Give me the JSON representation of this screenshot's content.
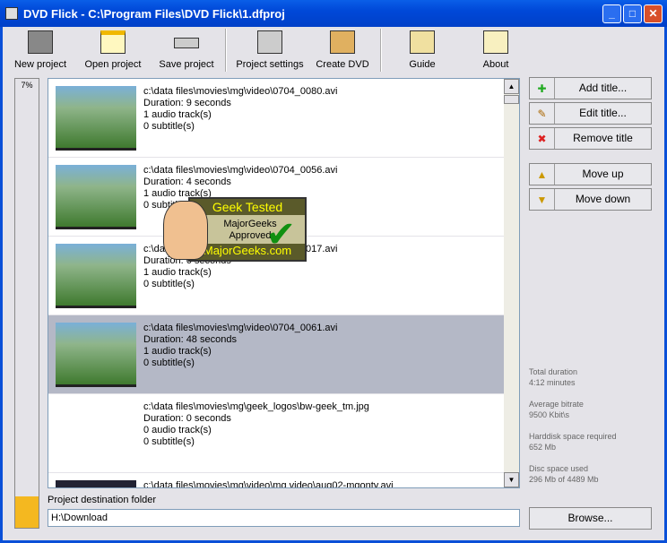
{
  "window": {
    "title": "DVD Flick - C:\\Program Files\\DVD Flick\\1.dfproj"
  },
  "toolbar": [
    {
      "label": "New project",
      "icon": "film-icon"
    },
    {
      "label": "Open project",
      "icon": "folder-icon"
    },
    {
      "label": "Save project",
      "icon": "drive-icon"
    },
    {
      "label": "Project settings",
      "icon": "settings-icon"
    },
    {
      "label": "Create DVD",
      "icon": "gears-icon"
    },
    {
      "label": "Guide",
      "icon": "guide-icon"
    },
    {
      "label": "About",
      "icon": "about-icon"
    }
  ],
  "progress": {
    "label": "7%",
    "value": 7
  },
  "titles": [
    {
      "path": "c:\\data files\\movies\\mg\\video\\0704_0080.avi",
      "duration": "Duration: 9 seconds",
      "audio": "1 audio track(s)",
      "subtitles": "0 subtitle(s)"
    },
    {
      "path": "c:\\data files\\movies\\mg\\video\\0704_0056.avi",
      "duration": "Duration: 4 seconds",
      "audio": "1 audio track(s)",
      "subtitles": "0 subtitle(s)"
    },
    {
      "path": "c:\\data files\\movies\\mg\\video\\0704_0017.avi",
      "duration": "Duration: 6 seconds",
      "audio": "1 audio track(s)",
      "subtitles": "0 subtitle(s)"
    },
    {
      "path": "c:\\data files\\movies\\mg\\video\\0704_0061.avi",
      "duration": "Duration: 48 seconds",
      "audio": "1 audio track(s)",
      "subtitles": "0 subtitle(s)"
    },
    {
      "path": "c:\\data files\\movies\\mg\\geek_logos\\bw-geek_tm.jpg",
      "duration": "Duration: 0 seconds",
      "audio": "0 audio track(s)",
      "subtitles": "0 subtitle(s)"
    },
    {
      "path": "c:\\data files\\movies\\mg\\video\\mg video\\aug02-mgonty.avi",
      "duration": "",
      "audio": "",
      "subtitles": ""
    }
  ],
  "buttons": {
    "add": "Add title...",
    "edit": "Edit title...",
    "remove": "Remove title",
    "up": "Move up",
    "down": "Move down",
    "browse": "Browse..."
  },
  "stats": [
    {
      "label": "Total duration",
      "value": "4:12 minutes"
    },
    {
      "label": "Average bitrate",
      "value": "9500 Kbit\\s"
    },
    {
      "label": "Harddisk space required",
      "value": "652 Mb"
    },
    {
      "label": "Disc space used",
      "value": "296 Mb of 4489 Mb"
    }
  ],
  "destination": {
    "label": "Project destination folder",
    "value": "H:\\Download"
  },
  "badge": {
    "title": "Geek Tested",
    "line1": "MajorGeeks",
    "line2": "Approved",
    "site": "MajorGeeks.com"
  }
}
